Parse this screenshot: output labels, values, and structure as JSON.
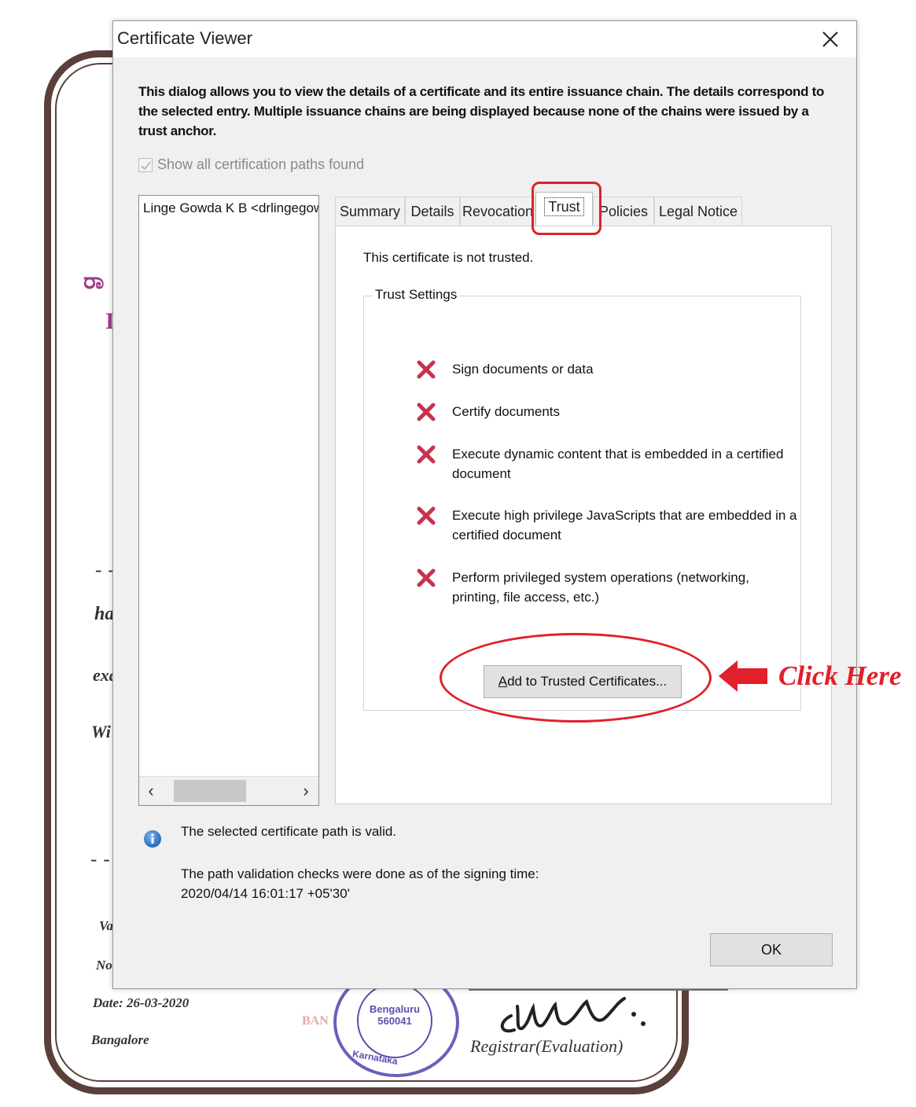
{
  "background_document": {
    "fragments": [
      "ha",
      "exa",
      "Wi",
      "Va",
      "No"
    ],
    "kannada_fragment": "ರಾ",
    "letter_fragment": "I",
    "date": "Date: 26-03-2020",
    "place": "Bangalore",
    "registrar": "Registrar(Evaluation)",
    "seal_text": "Bengaluru\n560041",
    "seal_ring": "Karnataka",
    "seal_side": "BAN"
  },
  "dialog": {
    "title": "Certificate Viewer",
    "description": "This dialog allows you to view the details of a certificate and its entire issuance chain. The details correspond to the selected entry. Multiple issuance chains are being displayed because none of the chains were issued by a trust anchor.",
    "show_all_paths_label": "Show all certification paths found",
    "show_all_paths_checked": true,
    "tree_item": "Linge Gowda K B <drlingegowda",
    "tabs": [
      "Summary",
      "Details",
      "Revocation",
      "Trust",
      "Policies",
      "Legal Notice"
    ],
    "active_tab": "Trust",
    "trust_panel": {
      "status": "This certificate is not trusted.",
      "group_title": "Trust Settings",
      "permissions": [
        "Sign documents or data",
        "Certify documents",
        "Execute dynamic content that is embedded in a certified document",
        "Execute high privilege JavaScripts that are embedded in a certified document",
        "Perform privileged system operations (networking, printing, file access, etc.)"
      ],
      "add_button_mnemonic": "A",
      "add_button_rest": "dd to Trusted Certificates..."
    },
    "info_valid": "The selected certificate path is valid.",
    "info_checks_line1": "The path validation checks were done as of the signing time:",
    "info_checks_line2": "2020/04/14 16:01:17 +05'30'",
    "ok_label": "OK"
  },
  "annotation": {
    "click_here": "Click Here",
    "color": "#e0202a"
  }
}
